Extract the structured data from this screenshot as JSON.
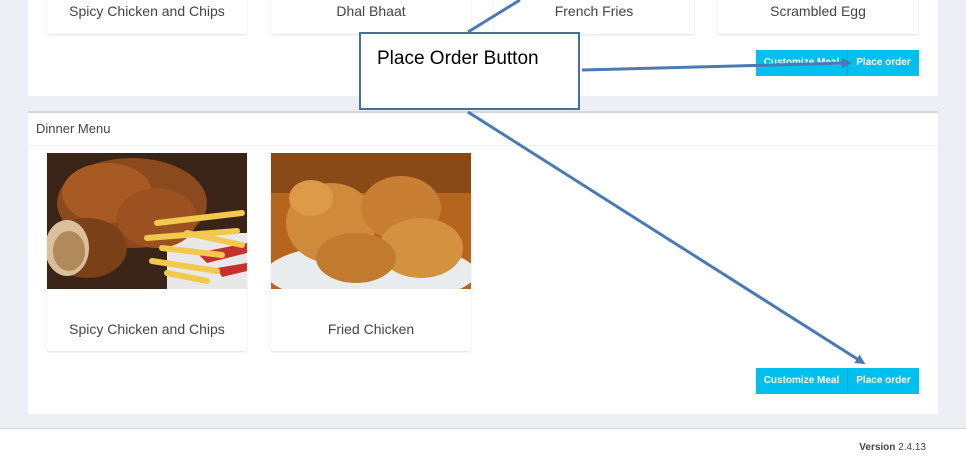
{
  "lunch": {
    "items": [
      {
        "name": "Spicy Chicken and Chips"
      },
      {
        "name": "Dhal Bhaat"
      },
      {
        "name": "French Fries"
      },
      {
        "name": "Scrambled Egg"
      }
    ],
    "customize_label": "Customize Meal",
    "place_order_label": "Place order"
  },
  "dinner": {
    "title": "Dinner Menu",
    "items": [
      {
        "name": "Spicy Chicken and Chips",
        "image": "fried-chicken-and-fries-photo"
      },
      {
        "name": "Fried Chicken",
        "image": "fried-chicken-photo"
      }
    ],
    "customize_label": "Customize Meal",
    "place_order_label": "Place order"
  },
  "annotation": {
    "text": "Place Order Button"
  },
  "footer": {
    "version_label": "Version",
    "version_number": "2.4.13"
  },
  "colors": {
    "button": "#00c0ef",
    "arrow": "#4a7ab5",
    "background": "#ecf0f5"
  }
}
